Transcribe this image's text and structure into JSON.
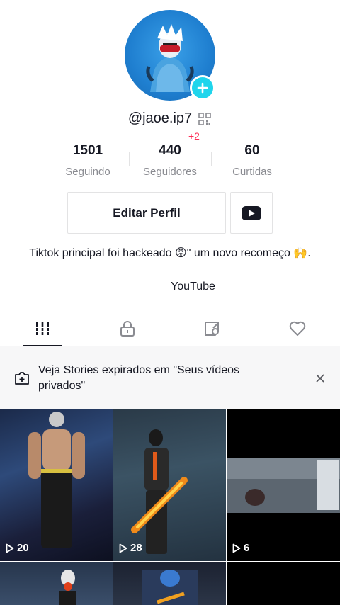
{
  "profile": {
    "username": "@jaoe.ip7",
    "notification_badge": "+2"
  },
  "stats": [
    {
      "value": "1501",
      "label": "Seguindo"
    },
    {
      "value": "440",
      "label": "Seguidores"
    },
    {
      "value": "60",
      "label": "Curtidas"
    }
  ],
  "actions": {
    "edit_profile": "Editar Perfil",
    "youtube_icon": "youtube-icon"
  },
  "bio": {
    "text": "Tiktok principal foi hackeado 😡\" um novo recomeço 🙌.",
    "link": "YouTube"
  },
  "tabs": [
    {
      "icon": "grid-icon",
      "active": true
    },
    {
      "icon": "lock-icon",
      "active": false
    },
    {
      "icon": "tagged-icon",
      "active": false
    },
    {
      "icon": "heart-icon",
      "active": false
    }
  ],
  "banner": {
    "text": "Veja Stories expirados em \"Seus vídeos privados\"",
    "icon": "camera-plus-icon"
  },
  "videos": [
    {
      "views": "20"
    },
    {
      "views": "28"
    },
    {
      "views": "6"
    },
    {
      "views": ""
    },
    {
      "views": ""
    },
    {
      "views": ""
    }
  ],
  "colors": {
    "accent": "#20d5ec",
    "badge": "#fe2c55",
    "text": "#161823",
    "muted": "#8a8b91"
  }
}
